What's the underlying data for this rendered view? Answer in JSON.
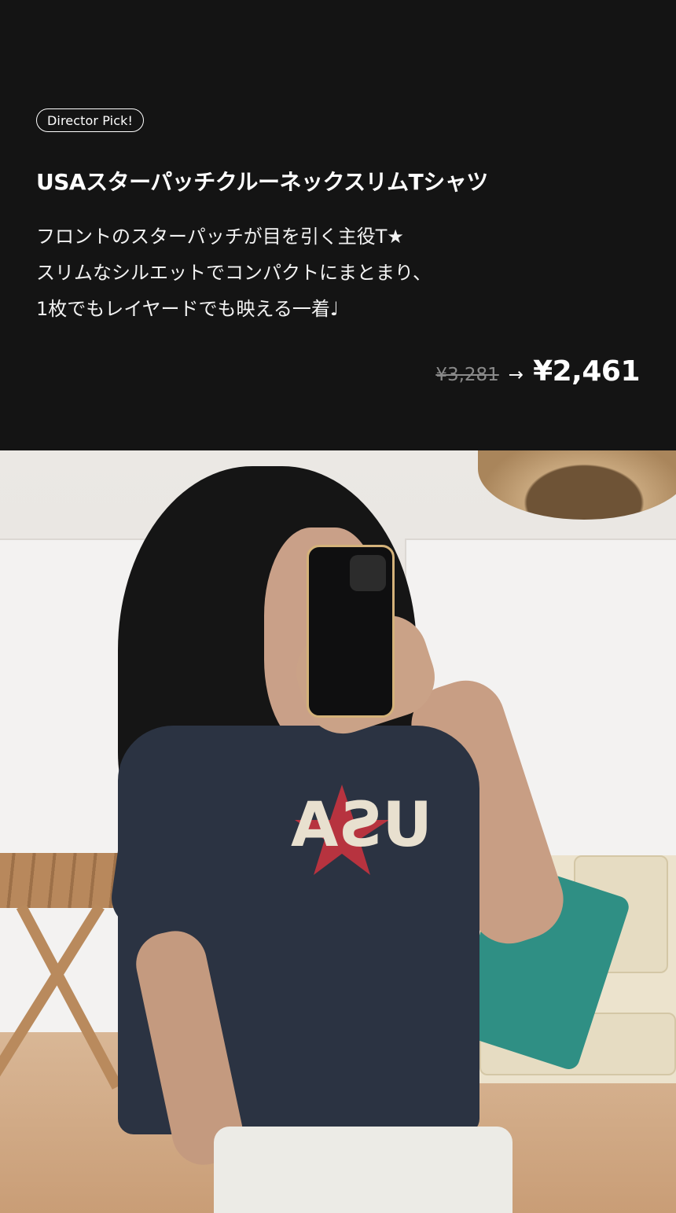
{
  "badge": "Director Pick!",
  "product": {
    "title": "USAスターパッチクルーネックスリムTシャツ",
    "description": [
      "フロントのスターパッチが目を引く主役T★",
      "スリムなシルエットでコンパクトにまとまり、",
      "1枚でもレイヤードでも映える一着♩"
    ],
    "price_original": "¥3,281",
    "price_arrow": "→",
    "price_sale": "¥2,461"
  },
  "photo": {
    "print_text": "USA",
    "colors": {
      "shirt": "#2b3342",
      "print": "#e8e0cf",
      "star": "#c7333f"
    }
  }
}
